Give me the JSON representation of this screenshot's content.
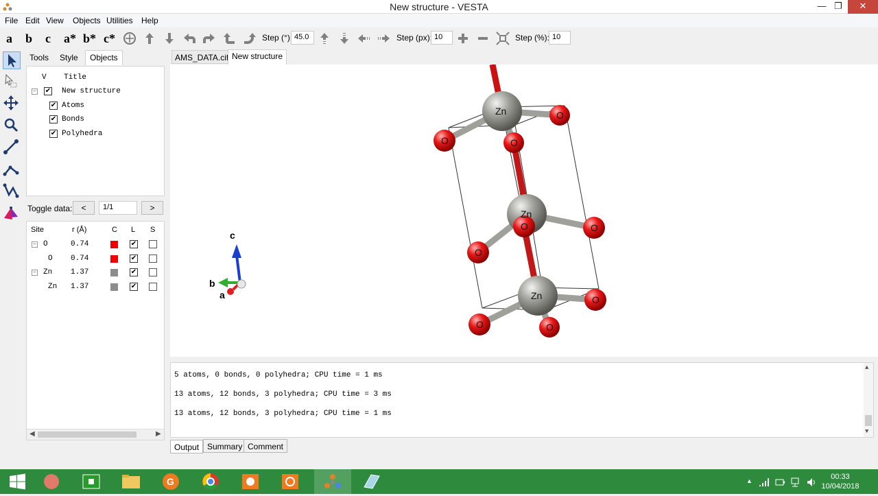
{
  "window": {
    "title": "New structure - VESTA"
  },
  "menu": [
    "File",
    "Edit",
    "View",
    "Objects",
    "Utilities",
    "Help"
  ],
  "toolbar": {
    "axes": [
      "a",
      "b",
      "c",
      "a*",
      "b*",
      "c*"
    ],
    "step_deg_label": "Step (°):",
    "step_deg_value": "45.0",
    "step_px_label": "Step (px):",
    "step_px_value": "10",
    "step_pct_label": "Step (%):",
    "step_pct_value": "10"
  },
  "left_tabs": [
    "Tools",
    "Style",
    "Objects"
  ],
  "object_tree": {
    "header_v": "V",
    "header_title": "Title",
    "root": "New structure",
    "children": [
      "Atoms",
      "Bonds",
      "Polyhedra"
    ]
  },
  "toggle": {
    "label": "Toggle data:",
    "prev": "<",
    "value": "1/1",
    "next": ">"
  },
  "site_table": {
    "headers": [
      "Site",
      "r (Å)",
      "C",
      "L",
      "S"
    ],
    "rows": [
      {
        "site": "O",
        "r": "0.74",
        "color": "#ee0000",
        "l": true,
        "s": false,
        "group": true
      },
      {
        "site": "O",
        "r": "0.74",
        "color": "#ee0000",
        "l": true,
        "s": false,
        "group": false
      },
      {
        "site": "Zn",
        "r": "1.37",
        "color": "#8c8c8c",
        "l": true,
        "s": false,
        "group": true
      },
      {
        "site": "Zn",
        "r": "1.37",
        "color": "#8c8c8c",
        "l": true,
        "s": false,
        "group": false
      }
    ]
  },
  "doc_tabs": [
    "AMS_DATA.cif",
    "New structure"
  ],
  "axes_labels": {
    "a": "a",
    "b": "b",
    "c": "c"
  },
  "atoms": {
    "zn_label": "Zn",
    "o_label": "O"
  },
  "output_lines": [
    "5 atoms, 0 bonds, 0 polyhedra; CPU time = 1 ms",
    "13 atoms, 12 bonds, 3 polyhedra; CPU time = 3 ms",
    "13 atoms, 12 bonds, 3 polyhedra; CPU time = 1 ms"
  ],
  "output_tabs": [
    "Output",
    "Summary",
    "Comment"
  ],
  "taskbar": {
    "time": "00:33",
    "date": "10/04/2018"
  },
  "colors": {
    "oxygen": "#e02020",
    "zinc": "#8c8c86",
    "axis_c": "#1a3fcf",
    "axis_b": "#2fae2f",
    "axis_a": "#e02020",
    "taskbar": "#2e8b3d"
  }
}
